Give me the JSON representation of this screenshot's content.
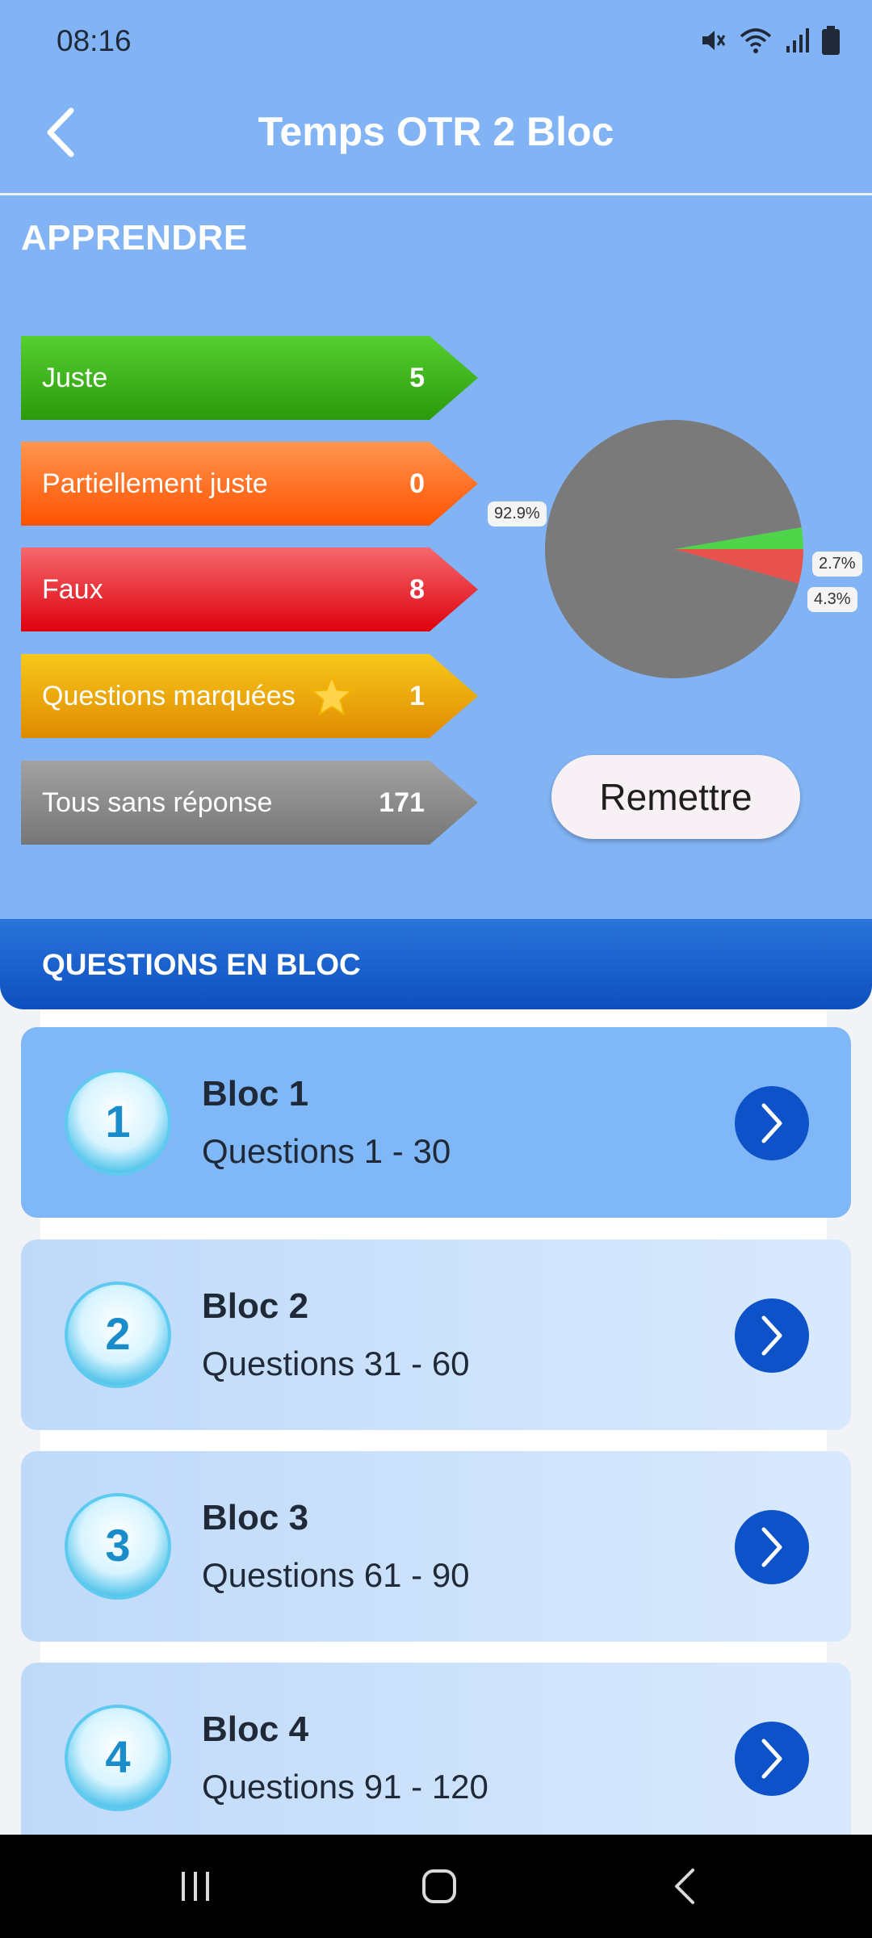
{
  "status_bar": {
    "time": "08:16"
  },
  "app_bar": {
    "title": "Temps OTR 2 Bloc"
  },
  "learn": {
    "heading": "APPRENDRE",
    "rows": [
      {
        "label": "Juste",
        "count": "5",
        "color_top": "#4ec62a",
        "color_bottom": "#2fa40f"
      },
      {
        "label": "Partiellement juste",
        "count": "0",
        "color_top": "#ff8a3a",
        "color_bottom": "#ff5a00"
      },
      {
        "label": "Faux",
        "count": "8",
        "color_top": "#f25a60",
        "color_bottom": "#e0000e"
      },
      {
        "label": "Questions marquées",
        "count": "1",
        "color_top": "#f7c51a",
        "color_bottom": "#e08d00"
      },
      {
        "label": "Tous sans réponse",
        "count": "171",
        "color_top": "#9a9a9a",
        "color_bottom": "#7a7a7a"
      }
    ],
    "reset_label": "Remettre"
  },
  "chart_data": {
    "type": "pie",
    "slices": [
      {
        "value": 92.9,
        "label": "92.9%",
        "color": "#7a7a7a"
      },
      {
        "value": 2.7,
        "label": "2.7%",
        "color": "#4fd44a"
      },
      {
        "value": 4.3,
        "label": "4.3%",
        "color": "#e8524c"
      }
    ]
  },
  "blocs": {
    "heading": "QUESTIONS EN BLOC",
    "items": [
      {
        "number": "1",
        "title": "Bloc 1",
        "range": "Questions 1 - 30"
      },
      {
        "number": "2",
        "title": "Bloc 2",
        "range": "Questions 31 - 60"
      },
      {
        "number": "3",
        "title": "Bloc 3",
        "range": "Questions 61 - 90"
      },
      {
        "number": "4",
        "title": "Bloc 4",
        "range": "Questions 91 - 120"
      }
    ]
  },
  "icons": {
    "back": "chevron-left-icon",
    "status": [
      "mute-icon",
      "wifi-icon",
      "signal-icon",
      "battery-icon"
    ],
    "star": "star-icon",
    "go": "chevron-right-icon",
    "nav": [
      "recents-icon",
      "home-icon",
      "nav-back-icon"
    ]
  },
  "colors": {
    "accent": "#0e52c9",
    "background": "#82b4f5"
  }
}
